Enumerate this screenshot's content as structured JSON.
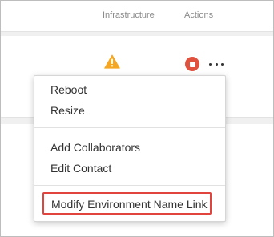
{
  "table": {
    "headers": {
      "infrastructure": "Infrastructure",
      "actions": "Actions"
    },
    "row": {
      "status_icon": "warning-icon",
      "stop_icon": "stop-icon",
      "more_icon": "more-horizontal-icon"
    }
  },
  "menu": {
    "items": [
      {
        "label": "Reboot"
      },
      {
        "label": "Resize"
      },
      {
        "label": "Add Collaborators"
      },
      {
        "label": "Edit Contact"
      },
      {
        "label": "Modify Environment Name Link"
      }
    ],
    "highlight_color": "#e0443c"
  },
  "colors": {
    "warning": "#f5a623",
    "stop": "#e0523e"
  }
}
